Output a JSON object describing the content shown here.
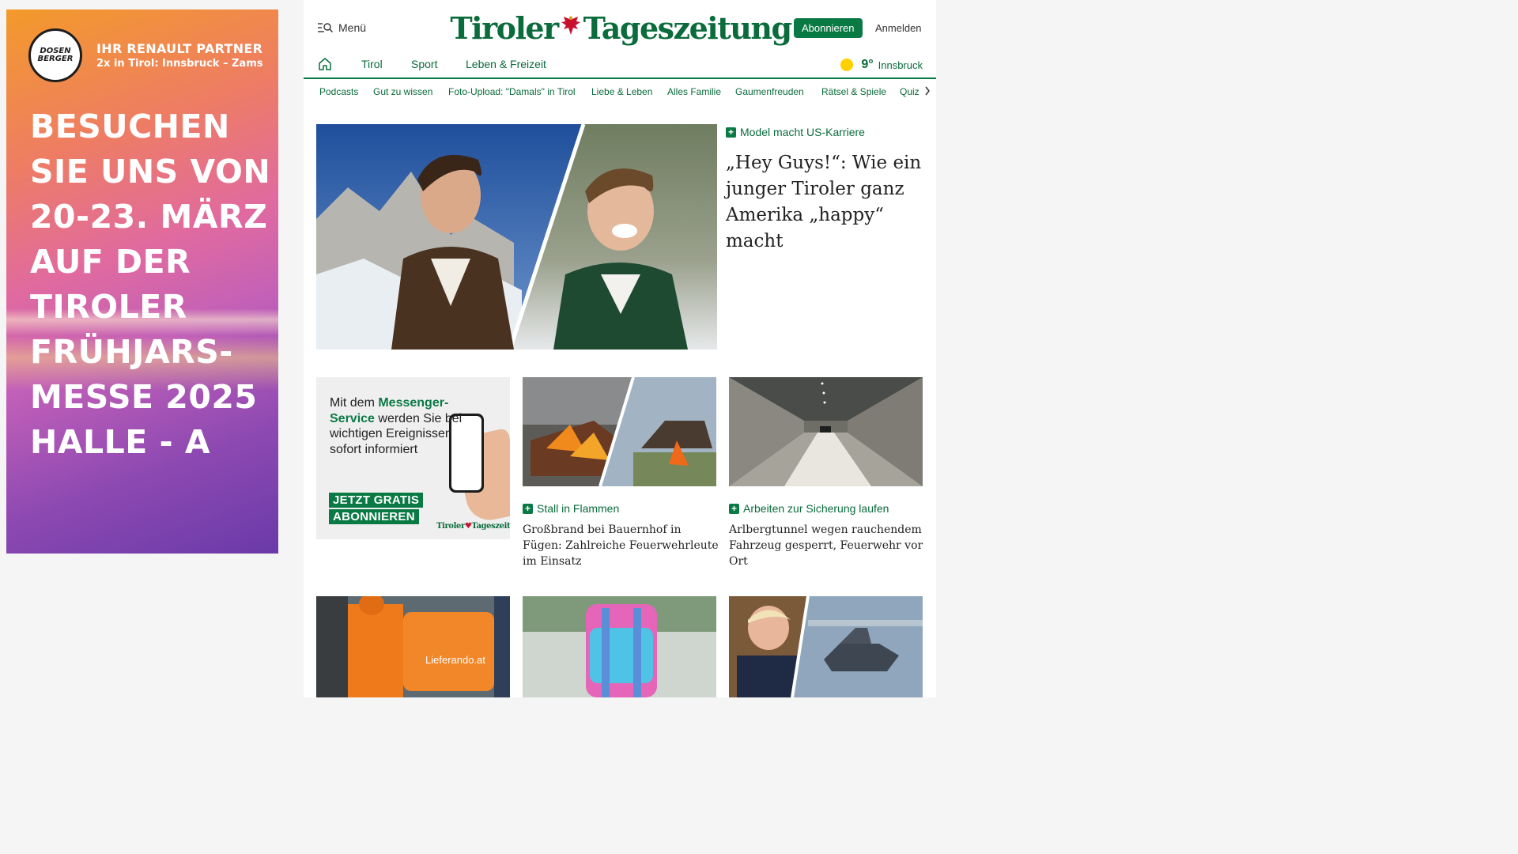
{
  "ad": {
    "logo_line1": "DOSEN",
    "logo_line2": "BERGER",
    "partner_line1": "IHR RENAULT PARTNER",
    "partner_line2": "2x in Tirol: Innsbruck – Zams",
    "headline": [
      "BESUCHEN",
      "SIE UNS VON",
      "20-23. MÄRZ",
      "AUF DER",
      "TIROLER",
      "FRÜHJARS-",
      "MESSE 2025",
      "HALLE - A"
    ]
  },
  "header": {
    "menu_label": "Menü",
    "logo_left": "Tiroler",
    "logo_right": "Tageszeitung",
    "subscribe_label": "Abonnieren",
    "login_label": "Anmelden"
  },
  "nav": {
    "items": [
      "Tirol",
      "Sport",
      "Leben & Freizeit"
    ],
    "weather_temp": "9°",
    "weather_city": "Innsbruck"
  },
  "subnav": {
    "items": [
      "Podcasts",
      "Gut zu wissen",
      "Foto-Upload: \"Damals\" in Tirol",
      "Liebe & Leben",
      "Alles Familie",
      "Gaumenfreuden",
      "Rätsel & Spiele",
      "Quiz"
    ]
  },
  "hero": {
    "kicker": "Model macht US-Karriere",
    "title": "„Hey Guys!“: Wie ein junger Tiroler ganz Amerika „happy“ macht"
  },
  "promo": {
    "text_prefix": "Mit dem ",
    "text_highlight": "Messenger-Service",
    "text_suffix": " werden Sie bei wichtigen Ereignissen sofort informiert",
    "cta_line1": "JETZT GRATIS",
    "cta_line2": "ABONNIEREN",
    "logo_left": "Tiroler",
    "logo_right": "Tageszeitung"
  },
  "cards": [
    {
      "kicker": "Stall in Flammen",
      "title": "Großbrand bei Bauernhof in Fügen: Zahlreiche Feuerwehrleute im Einsatz"
    },
    {
      "kicker": "Arbeiten zur Sicherung laufen",
      "title": "Arlbergtunnel wegen rauchendem Fahrzeug gesperrt, Feuerwehr vor Ort"
    }
  ],
  "bottom_images": {
    "delivery_brand": "Lieferando.at"
  },
  "colors": {
    "brand_green": "#0a7a45",
    "eagle_red": "#c8102e",
    "sun_yellow": "#ffd000"
  }
}
